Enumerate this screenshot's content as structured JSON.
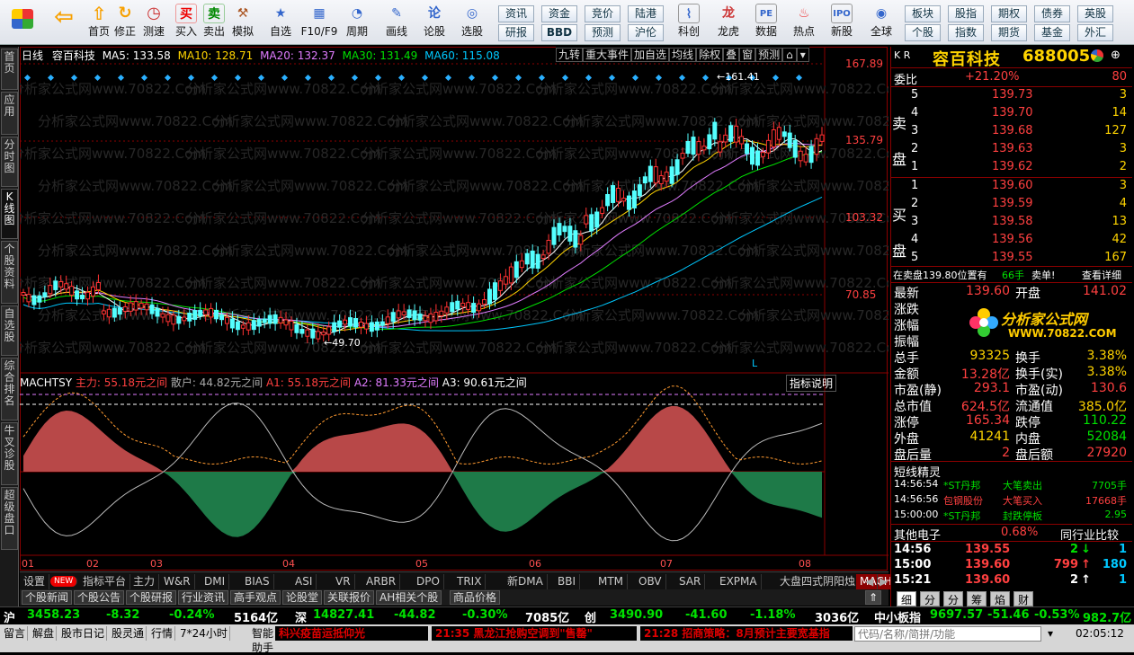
{
  "toolbar": {
    "buttons": [
      {
        "label": "",
        "icon": "windows-grid-icon"
      },
      {
        "label": "",
        "icon": "back-arrow-icon"
      },
      {
        "label": "首页",
        "icon": "up-arrow-icon"
      },
      {
        "label": "修正",
        "icon": "revise-icon"
      },
      {
        "label": "测速",
        "icon": "speed-icon"
      },
      {
        "label": "买入",
        "icon": "buy-icon"
      },
      {
        "label": "卖出",
        "icon": "sell-icon"
      },
      {
        "label": "模拟",
        "icon": "gavel-icon"
      },
      {
        "label": "自选",
        "icon": "star-icon"
      },
      {
        "label": "F10/F9",
        "icon": "f10-icon"
      },
      {
        "label": "周期",
        "icon": "clock-icon"
      },
      {
        "label": "画线",
        "icon": "pen-icon"
      },
      {
        "label": "论股",
        "icon": "discuss-icon"
      },
      {
        "label": "选股",
        "icon": "select-icon"
      }
    ],
    "quick1": [
      "资讯",
      "资金",
      "竞价",
      "陆港",
      "研报",
      "BBD",
      "预测",
      "沪伦"
    ],
    "tools": [
      "科创",
      "龙虎",
      "数据",
      "热点",
      "新股"
    ],
    "quick2": [
      "全球"
    ],
    "quick3": [
      "板块",
      "股指",
      "期权",
      "债券",
      "英股",
      "个股",
      "指数",
      "期货",
      "基金",
      "外汇"
    ]
  },
  "leftbar": [
    "首页",
    "应用",
    "分时图",
    "K线图",
    "个股资料",
    "自选股",
    "综合排名",
    "牛叉诊股",
    "超级盘口"
  ],
  "chart": {
    "period": "日线",
    "stock_name": "容百科技",
    "ma5": "MA5: 133.58",
    "ma10": "MA10: 128.71",
    "ma20": "MA20: 132.37",
    "ma30": "MA30: 131.49",
    "ma60": "MA60: 115.08",
    "top_buttons": [
      "九转",
      "重大事件",
      "加自选",
      "均线",
      "除权",
      "叠",
      "窗",
      "预测"
    ],
    "price_ticks": [
      "167.89",
      "135.79",
      "103.32",
      "70.85"
    ],
    "high_label": "161.41",
    "low_label": "49.70",
    "l_marker": "L",
    "watermark": "分析家公式网www.70822.Com",
    "indicator_title": "MACHTSY",
    "ind_main": "主力: 55.18元之间",
    "ind_retail": "散户: 44.82元之间",
    "ind_a1": "A1: 55.18元之间",
    "ind_a2": "A2: 81.33元之间",
    "ind_a3": "A3: 90.61元之间",
    "ind_help": "指标说明",
    "months": [
      "01",
      "02",
      "03",
      "04",
      "05",
      "06",
      "07",
      "08"
    ]
  },
  "tabs": [
    "设置",
    "NEW",
    "指标平台",
    "主力",
    "W&R",
    "DMI",
    "BIAS",
    "ASI",
    "VR",
    "ARBR",
    "DPO",
    "TRIX",
    "新DMA",
    "BBI",
    "MTM",
    "OBV",
    "SAR",
    "EXPMA",
    "大盘四式阴阳烛",
    "MACHTSY"
  ],
  "tabs2": [
    "个股新闻",
    "个股公告",
    "个股研报",
    "行业资讯",
    "高手观点",
    "论股堂",
    "关联报价",
    "AH相关个股",
    "商品价格"
  ],
  "right": {
    "market": "K R",
    "name": "容百科技",
    "code": "688005",
    "webi_label": "委比",
    "webi": "+21.20%",
    "weicha": "80",
    "sell_label": "卖盘",
    "buy_label": "买盘",
    "asks": [
      {
        "lvl": "5",
        "price": "139.73",
        "vol": "3"
      },
      {
        "lvl": "4",
        "price": "139.70",
        "vol": "14"
      },
      {
        "lvl": "3",
        "price": "139.68",
        "vol": "127"
      },
      {
        "lvl": "2",
        "price": "139.63",
        "vol": "3"
      },
      {
        "lvl": "1",
        "price": "139.62",
        "vol": "2"
      }
    ],
    "bids": [
      {
        "lvl": "1",
        "price": "139.60",
        "vol": "3"
      },
      {
        "lvl": "2",
        "price": "139.59",
        "vol": "4"
      },
      {
        "lvl": "3",
        "price": "139.58",
        "vol": "13"
      },
      {
        "lvl": "4",
        "price": "139.56",
        "vol": "42"
      },
      {
        "lvl": "5",
        "price": "139.55",
        "vol": "167"
      }
    ],
    "position_text": "在卖盘139.80位置有",
    "position_vol": "66手",
    "position_tag": "卖单!",
    "detail_btn": "查看详细",
    "stats": [
      {
        "k1": "最新",
        "v1": "139.60",
        "k2": "开盘",
        "v2": "141.02"
      },
      {
        "k1": "涨跌",
        "v1": "",
        "k2": "",
        "v2": ""
      },
      {
        "k1": "涨幅",
        "v1": "",
        "k2": "",
        "v2": ""
      },
      {
        "k1": "振幅",
        "v1": "",
        "k2": "",
        "v2": ""
      },
      {
        "k1": "总手",
        "v1": "93325",
        "k2": "换手",
        "v2": "3.38%"
      },
      {
        "k1": "金额",
        "v1": "13.28亿",
        "k2": "换手(实)",
        "v2": "3.38%"
      },
      {
        "k1": "市盈(静)",
        "v1": "293.1",
        "k2": "市盈(动)",
        "v2": "130.6"
      },
      {
        "k1": "总市值",
        "v1": "624.5亿",
        "k2": "流通值",
        "v2": "385.0亿"
      },
      {
        "k1": "涨停",
        "v1": "165.34",
        "k2": "跌停",
        "v2": "110.22"
      },
      {
        "k1": "外盘",
        "v1": "41241",
        "k2": "内盘",
        "v2": "52084"
      },
      {
        "k1": "盘后量",
        "v1": "2",
        "k2": "盘后额",
        "v2": "27920"
      }
    ],
    "logo_text": "分析家公式网",
    "logo_url": "WWW.70822.COM",
    "short_title": "短线精灵",
    "short": [
      {
        "t": "14:56:54",
        "n": "*ST丹邦",
        "e": "大笔卖出",
        "v": "7705手"
      },
      {
        "t": "14:56:56",
        "n": "包钢股份",
        "e": "大笔买入",
        "v": "17668手"
      },
      {
        "t": "15:00:00",
        "n": "*ST丹邦",
        "e": "封跌停板",
        "v": "2.95"
      }
    ],
    "other_label": "其他电子",
    "other_pct": "0.68%",
    "peer_btn": "同行业比较",
    "ticks": [
      {
        "t": "14:56",
        "p": "139.55",
        "v": "2",
        "arrow": "↓",
        "n": "1"
      },
      {
        "t": "15:00",
        "p": "139.60",
        "v": "799",
        "arrow": "↑",
        "n": "180"
      },
      {
        "t": "15:21",
        "p": "139.60",
        "v": "2",
        "arrow": "↑",
        "n": "1"
      }
    ],
    "bottom_tabs": [
      "细",
      "分",
      "分",
      "筹",
      "焰",
      "财"
    ]
  },
  "status": {
    "sh_label": "沪",
    "sh_val": "3458.23",
    "sh_chg": "-8.32",
    "sh_pct": "-0.24%",
    "sh_amt": "5164亿",
    "sz_label": "深",
    "sz_val": "14827.41",
    "sz_chg": "-44.82",
    "sz_pct": "-0.30%",
    "sz_amt": "7085亿",
    "cy_label": "创",
    "cy_val": "3490.90",
    "cy_chg": "-41.60",
    "cy_pct": "-1.18%",
    "cy_amt": "3036亿",
    "zx_label": "中小板指",
    "zx_val": "9697.57",
    "zx_chg": "-51.46",
    "zx_pct": "-0.53%",
    "zx_amt": "982.7亿"
  },
  "bottom": {
    "items": [
      "留言",
      "解盘",
      "股市日记",
      "股灵通",
      "行情",
      "7*24小时",
      "智能助手"
    ],
    "news1": "科兴疫苗运抵仰光",
    "news2": "21:35 黑龙江抢购空调到\"售罄\"",
    "news3": "21:28 招商策略：8月预计主要宽基指",
    "search_placeholder": "代码/名称/简拼/功能",
    "clock": "02:05:12"
  }
}
